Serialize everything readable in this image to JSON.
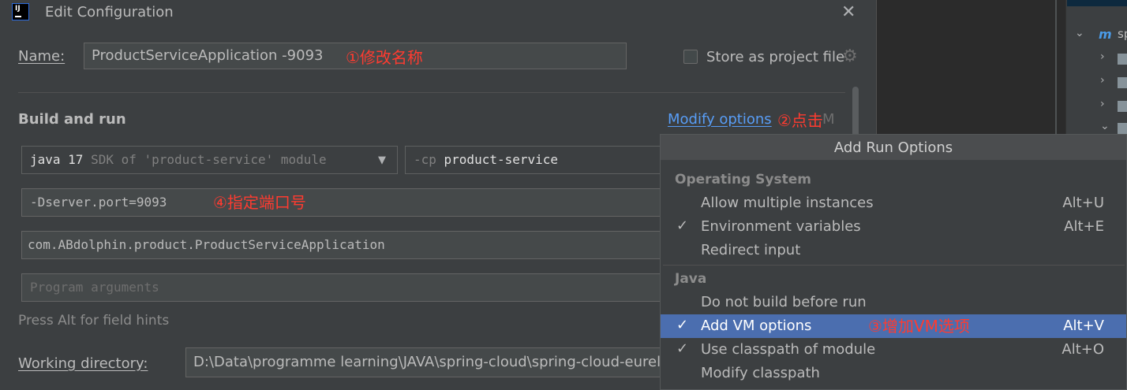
{
  "dialog": {
    "title": "Edit Configuration",
    "name_label": "Name:",
    "name_value": "ProductServiceApplication -9093",
    "store_label": "Store as project file",
    "store_checked": false
  },
  "build_run": {
    "section_title": "Build and run",
    "modify_options_label": "Modify options",
    "modify_hint": "M",
    "jdk_keyword": "java 17",
    "jdk_detail": " SDK of 'product-service' module",
    "cp_flag": "-cp ",
    "cp_value": "product-service",
    "vm_options": "-Dserver.port=9093",
    "main_class": "com.ABdolphin.product.ProductServiceApplication",
    "program_args_placeholder": "Program arguments",
    "hint": "Press Alt for field hints",
    "working_dir_label": "Working directory:",
    "working_dir_value": "D:\\Data\\programme learning\\JAVA\\spring-cloud\\spring-cloud-eurel"
  },
  "annotations": {
    "a1": "①修改名称",
    "a2": "②点击",
    "a3": "③增加VM选项",
    "a4": "④指定端口号",
    "color": "#ff3b30"
  },
  "popup": {
    "title": "Add Run Options",
    "groups": [
      {
        "title": "Operating System",
        "items": [
          {
            "label": "Allow multiple instances",
            "shortcut": "Alt+U",
            "checked": false
          },
          {
            "label": "Environment variables",
            "shortcut": "Alt+E",
            "checked": true
          },
          {
            "label": "Redirect input",
            "shortcut": "",
            "checked": false
          }
        ]
      },
      {
        "title": "Java",
        "items": [
          {
            "label": "Do not build before run",
            "shortcut": "",
            "checked": false
          },
          {
            "label": "Add VM options",
            "shortcut": "Alt+V",
            "checked": true,
            "selected": true
          },
          {
            "label": "Use classpath of module",
            "shortcut": "Alt+O",
            "checked": true
          },
          {
            "label": "Modify classpath",
            "shortcut": "",
            "checked": false
          }
        ]
      }
    ],
    "check_glyph": "✓"
  },
  "project_tree": {
    "root_label": "sp"
  },
  "colors": {
    "accent_link": "#589df6",
    "selection": "#4b6eaf",
    "background": "#3c3f41"
  }
}
